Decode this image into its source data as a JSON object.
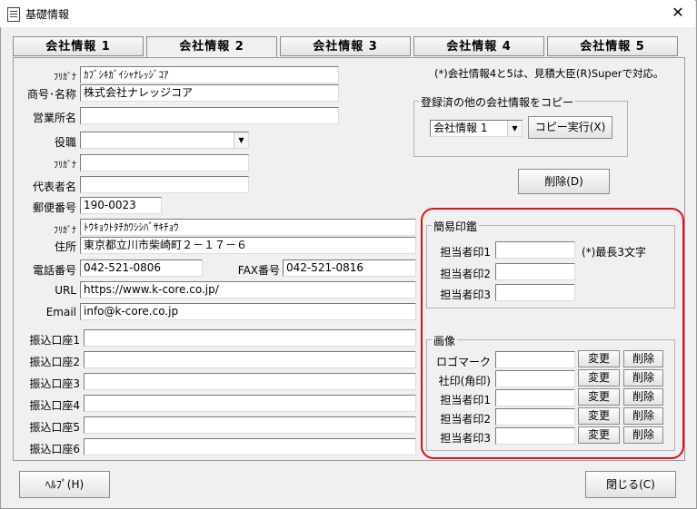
{
  "window": {
    "title": "基礎情報",
    "close_glyph": "✕"
  },
  "tabs": [
    "会社情報 1",
    "会社情報 2",
    "会社情報 3",
    "会社情報 4",
    "会社情報 5"
  ],
  "active_tab": 1,
  "note": "(*)会社情報4と5は、見積大臣(R)Superで対応。",
  "form": {
    "furigana1_label": "ﾌﾘｶﾞﾅ",
    "furigana1_value": "ｶﾌﾞｼｷｶﾞｲｼｬﾅﾚｯｼﾞｺｱ",
    "company_label": "商号･名称",
    "company_value": "株式会社ナレッジコア",
    "office_label": "営業所名",
    "office_value": "",
    "title_label": "役職",
    "title_value": "",
    "furigana2_label": "ﾌﾘｶﾞﾅ",
    "furigana2_value": "",
    "rep_label": "代表者名",
    "rep_value": "",
    "zip_label": "郵便番号",
    "zip_value": "190-0023",
    "furigana3_label": "ﾌﾘｶﾞﾅ",
    "furigana3_value": "ﾄｳｷｮｳﾄﾀﾁｶﾜｼｼﾊﾞｻｷﾁｮｳ",
    "address_label": "住所",
    "address_value": "東京都立川市柴崎町２－１７－６",
    "tel_label": "電話番号",
    "tel_value": "042-521-0806",
    "fax_label": "FAX番号",
    "fax_value": "042-521-0816",
    "url_label": "URL",
    "url_value": "https://www.k-core.co.jp/",
    "email_label": "Email",
    "email_value": "info@k-core.co.jp",
    "bank_labels": [
      "振込口座1",
      "振込口座2",
      "振込口座3",
      "振込口座4",
      "振込口座5",
      "振込口座6"
    ]
  },
  "copy_group": {
    "title": "登録済の他の会社情報をコピー",
    "select_value": "会社情報 1",
    "button": "コピー実行(X)"
  },
  "delete_button": "削除(D)",
  "seal_group": {
    "title": "簡易印鑑",
    "rows": [
      "担当者印1",
      "担当者印2",
      "担当者印3"
    ],
    "hint": "(*)最長3文字"
  },
  "image_group": {
    "title": "画像",
    "rows": [
      "ロゴマーク",
      "社印(角印)",
      "担当者印1",
      "担当者印2",
      "担当者印3"
    ],
    "change_label": "変更",
    "delete_label": "削除"
  },
  "footer": {
    "help": "ﾍﾙﾌﾟ(H)",
    "close": "閉じる(C)"
  }
}
